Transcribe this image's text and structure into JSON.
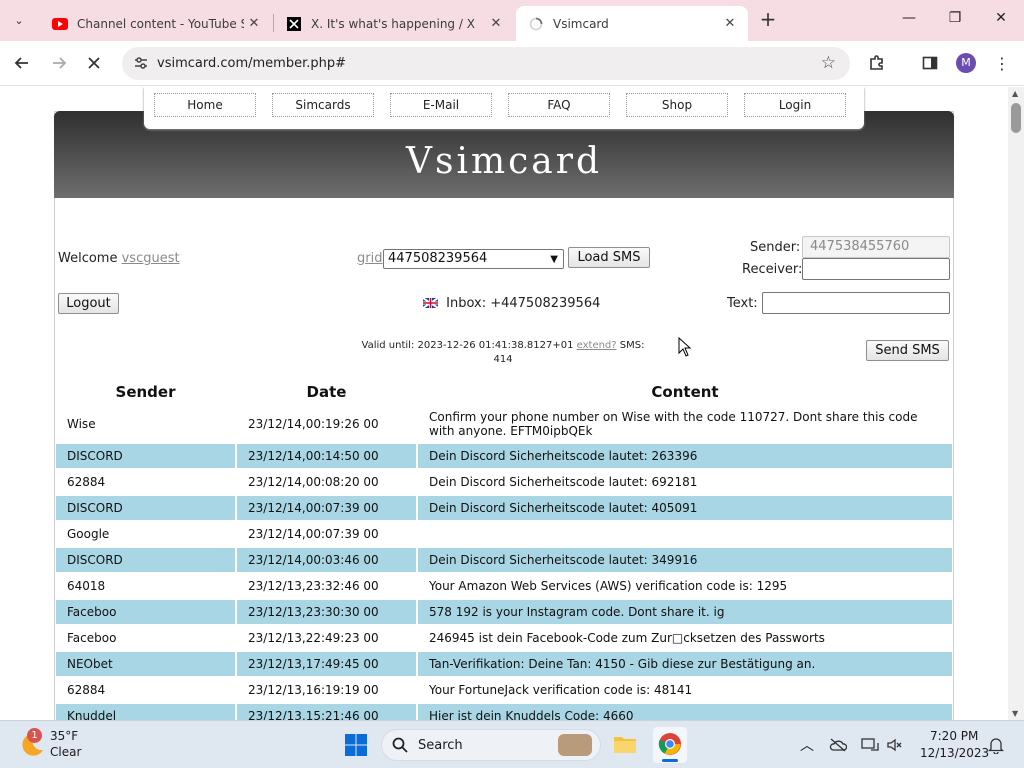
{
  "browser": {
    "tabs": [
      {
        "title": "Channel content - YouTube Studio",
        "icon": "youtube-icon"
      },
      {
        "title": "X. It's what's happening / X",
        "icon": "x-logo-icon"
      },
      {
        "title": "Vsimcard",
        "icon": "loading-spinner-icon"
      }
    ],
    "url": "vsimcard.com/member.php#",
    "profile_initial": "M"
  },
  "site": {
    "logo": "Vsimcard",
    "nav": [
      "Home",
      "Simcards",
      "E-Mail",
      "FAQ",
      "Shop",
      "Login"
    ],
    "welcome_label": "Welcome",
    "username": "vscguest",
    "logout_label": "Logout",
    "grid_label": "grid",
    "selected_number": "447508239564",
    "load_sms_label": "Load SMS",
    "inbox_label": "Inbox: +447508239564",
    "valid_until_label": "Valid until: 2023-12-26 01:41:38.8127+01",
    "extend_label": "extend?",
    "sms_count_label": "SMS:",
    "sms_count": "414",
    "sender_label": "Sender:",
    "sender_value": "447538455760",
    "receiver_label": "Receiver:",
    "receiver_value": "",
    "text_label": "Text:",
    "text_value": "",
    "send_sms_label": "Send SMS"
  },
  "table": {
    "headers": [
      "Sender",
      "Date",
      "Content"
    ],
    "rows": [
      {
        "sender": "Wise",
        "date": "23/12/14,00:19:26 00",
        "content": "Confirm your phone number on Wise with the code 110727. Dont share this code with anyone. EFTM0ipbQEk"
      },
      {
        "sender": "DISCORD",
        "date": "23/12/14,00:14:50 00",
        "content": "Dein Discord Sicherheitscode lautet: 263396"
      },
      {
        "sender": "62884",
        "date": "23/12/14,00:08:20 00",
        "content": "Dein Discord Sicherheitscode lautet: 692181"
      },
      {
        "sender": "DISCORD",
        "date": "23/12/14,00:07:39 00",
        "content": "Dein Discord Sicherheitscode lautet: 405091"
      },
      {
        "sender": "Google",
        "date": "23/12/14,00:07:39 00",
        "content": ""
      },
      {
        "sender": "DISCORD",
        "date": "23/12/14,00:03:46 00",
        "content": "Dein Discord Sicherheitscode lautet: 349916"
      },
      {
        "sender": "64018",
        "date": "23/12/13,23:32:46 00",
        "content": "Your Amazon Web Services (AWS) verification code is: 1295"
      },
      {
        "sender": "Faceboo",
        "date": "23/12/13,23:30:30 00",
        "content": "578 192 is your Instagram code. Dont share it. ig"
      },
      {
        "sender": "Faceboo",
        "date": "23/12/13,22:49:23 00",
        "content": "246945 ist dein Facebook-Code zum Zur□cksetzen des Passworts"
      },
      {
        "sender": "NEObet",
        "date": "23/12/13,17:49:45 00",
        "content": "Tan-Verifikation: Deine Tan: 4150 - Gib diese zur Bestätigung an."
      },
      {
        "sender": "62884",
        "date": "23/12/13,16:19:19 00",
        "content": "Your FortuneJack verification code is: 48141"
      },
      {
        "sender": "Knuddel",
        "date": "23/12/13,15:21:46 00",
        "content": "Hier ist dein Knuddels Code: 4660"
      }
    ]
  },
  "taskbar": {
    "weather_temp": "35°F",
    "weather_desc": "Clear",
    "weather_badge": "1",
    "search_label": "Search",
    "time": "7:20 PM",
    "date": "12/13/2023"
  },
  "colors": {
    "tab_strip": "#f5dde3",
    "row_highlight": "#a9d6e5",
    "header_dark": "#2f2f2f"
  }
}
